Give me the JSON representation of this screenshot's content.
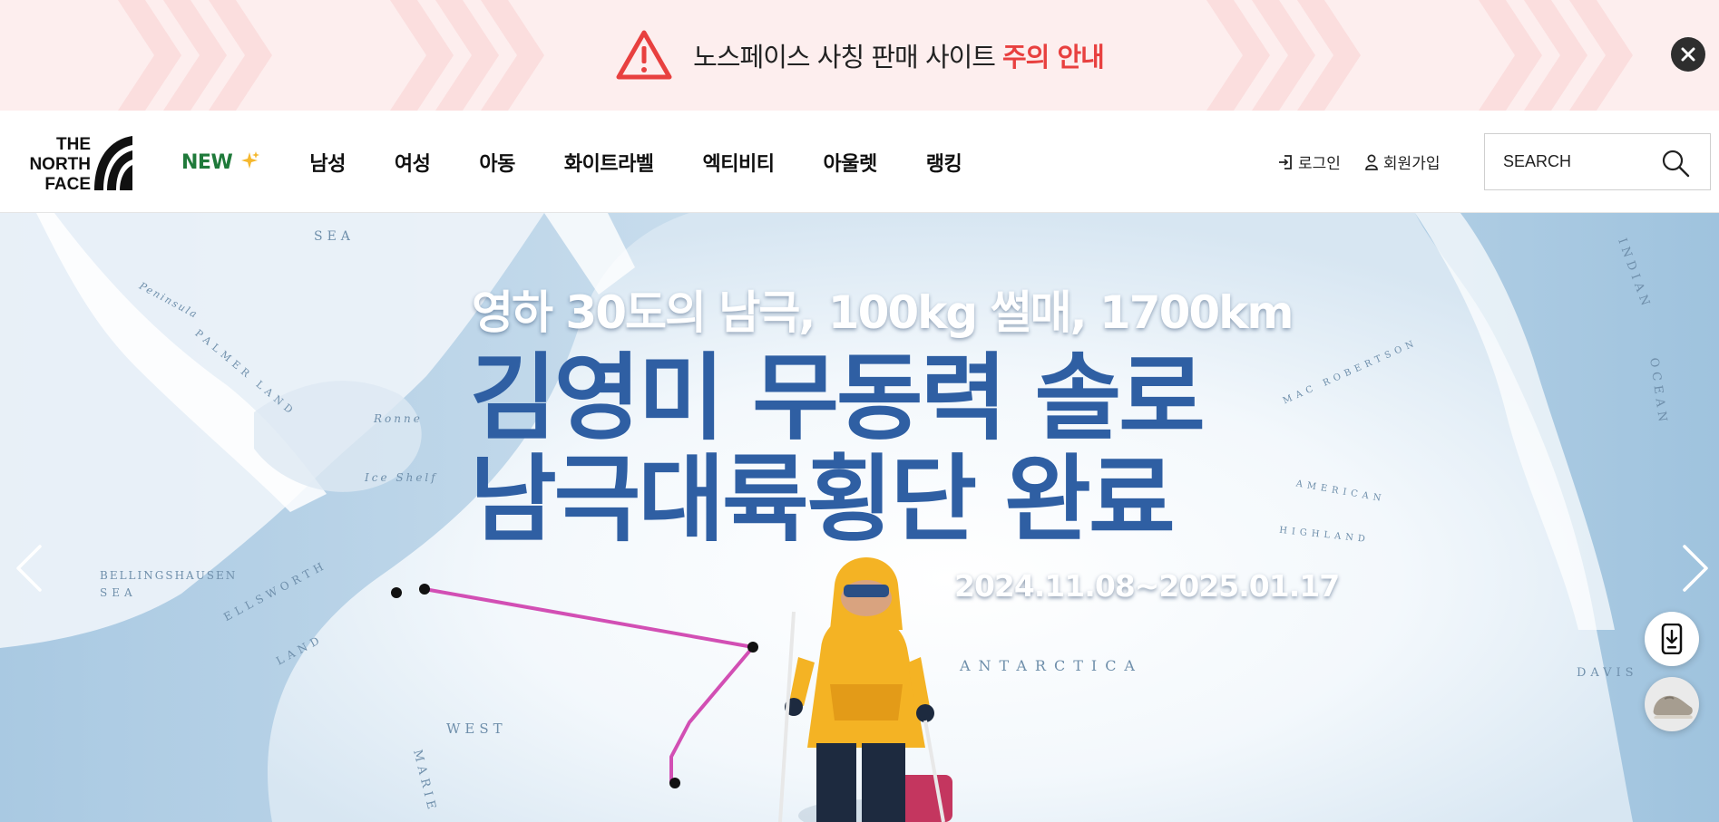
{
  "notice": {
    "text": "노스페이스 사칭 판매 사이트",
    "accent_text": "주의 안내",
    "accent_color": "#e8403f",
    "background": "#fdeeee",
    "icon": "warning-triangle-icon",
    "close_icon": "close-icon"
  },
  "header": {
    "logo_lines": [
      "THE",
      "NORTH",
      "FACE"
    ],
    "nav": [
      {
        "label": "NEW",
        "icon": "sparkle-icon"
      },
      {
        "label": "남성"
      },
      {
        "label": "여성"
      },
      {
        "label": "아동"
      },
      {
        "label": "화이트라벨"
      },
      {
        "label": "엑티비티"
      },
      {
        "label": "아울렛"
      },
      {
        "label": "랭킹"
      }
    ],
    "util": {
      "login_label": "로그인",
      "join_label": "회원가입"
    },
    "search": {
      "placeholder": "SEARCH"
    }
  },
  "hero": {
    "subtitle": "영하 30도의 남극, 100kg 썰매, 1700km",
    "title_line1": "김영미 무동력 솔로",
    "title_line2": "남극대륙횡단 완료",
    "date": "2024.11.08~2025.01.17",
    "title_color": "#2f5fa3",
    "route_color": "#d24fb4",
    "map_labels": {
      "antarctica": "ANTARCTICA",
      "sea": "SEA",
      "sea_left": "SEA",
      "bellingshausen": "BELLINGSHAUSEN",
      "west": "WEST",
      "ellsworth": "ELLSWORTH",
      "land": "LAND",
      "indian": "INDIAN",
      "ocean": "OCEAN",
      "davis": "DAVIS",
      "palmer_land": "PALMER LAND",
      "american": "AMERICAN",
      "highland": "HIGHLAND",
      "robertson": "MAC ROBERTSON",
      "marie": "MARIE",
      "ice_shelf": "Ice Shelf",
      "ronne": "Ronne",
      "peninsula": "Peninsula"
    }
  },
  "side": {
    "app_icon": "mobile-download-icon",
    "product_icon": "shoe-thumbnail-icon"
  }
}
